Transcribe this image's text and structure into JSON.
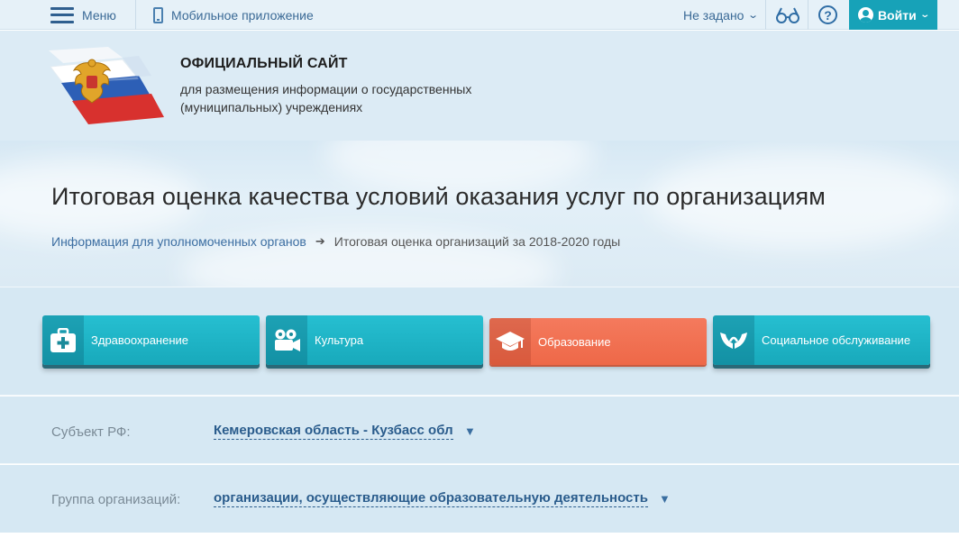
{
  "topbar": {
    "menu_label": "Меню",
    "mobile_label": "Мобильное приложение",
    "region_label": "Не задано",
    "login_label": "Войти"
  },
  "header": {
    "title": "ОФИЦИАЛЬНЫЙ САЙТ",
    "subtitle": "для размещения информации о государственных (муниципальных) учреждениях"
  },
  "hero": {
    "title": "Итоговая оценка качества условий оказания услуг по организациям",
    "breadcrumb": {
      "link": "Информация для уполномоченных органов",
      "current": "Итоговая оценка организаций за 2018-2020 годы"
    }
  },
  "categories": [
    {
      "label": "Здравоохранение",
      "icon": "medkit-icon",
      "active": false
    },
    {
      "label": "Культура",
      "icon": "film-camera-icon",
      "active": false
    },
    {
      "label": "Образование",
      "icon": "graduation-cap-icon",
      "active": true
    },
    {
      "label": "Социальное обслуживание",
      "icon": "hands-icon",
      "active": false
    }
  ],
  "filters": {
    "subject_label": "Субъект РФ:",
    "subject_value": "Кемеровская область - Кузбасс обл",
    "group_label": "Группа организаций:",
    "group_value": "организации, осуществляющие образовательную деятельность"
  },
  "colors": {
    "teal": "#1fb4c6",
    "orange": "#f07254",
    "link": "#3c6ea2"
  }
}
